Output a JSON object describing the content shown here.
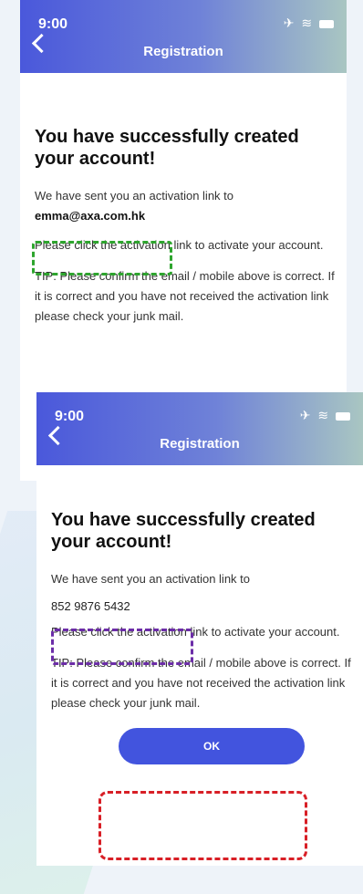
{
  "screens": [
    {
      "status": {
        "time": "9:00"
      },
      "nav": {
        "title": "Registration"
      },
      "content": {
        "heading": "You have successfully created your account!",
        "sent_text": "We have sent you an activation link to",
        "contact": "emma@axa.com.hk",
        "instruction": "Please click the activation link to activate your account.",
        "tip": "TIP: Please confirm the email / mobile above is correct. If it is correct and you have not received the activation link please check your junk mail."
      }
    },
    {
      "status": {
        "time": "9:00"
      },
      "nav": {
        "title": "Registration"
      },
      "content": {
        "heading": "You have successfully created your account!",
        "sent_text": "We have sent you an activation link to",
        "contact": "852 9876 5432",
        "instruction": "Please click the activation link to activate your account.",
        "tip": "TIP: Please confirm the email / mobile above is correct. If it is correct and you have not received the activation link please check your junk mail.",
        "ok_label": "OK"
      }
    }
  ],
  "annotations": {
    "colors": {
      "green": "#2ea52e",
      "purple": "#6c2da8",
      "red": "#d81f26"
    }
  },
  "theme": {
    "accent": "#4254de",
    "header_gradient": [
      "#4a58db",
      "#a9c6c2"
    ]
  }
}
